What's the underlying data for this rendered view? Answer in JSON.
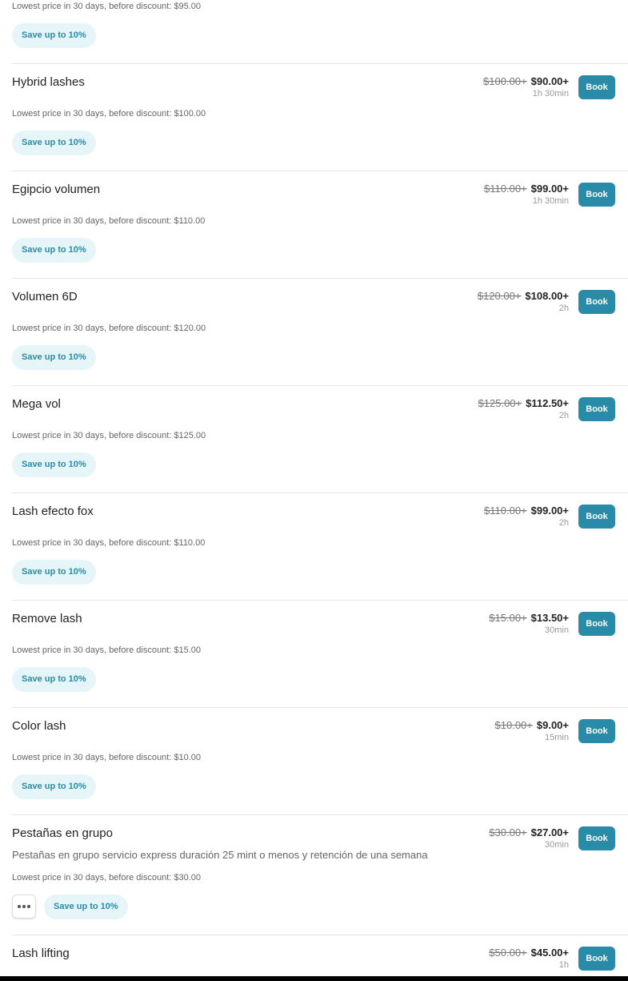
{
  "top_partial": {
    "lowest_price": "Lowest price in 30 days, before discount: $95.00",
    "badge": "Save up to 10%"
  },
  "services": [
    {
      "name": "Hybrid lashes",
      "old_price": "$100.00+",
      "new_price": "$90.00+",
      "duration": "1h 30min",
      "lowest_price": "Lowest price in 30 days, before discount: $100.00",
      "badge": "Save up to 10%",
      "book_label": "Book"
    },
    {
      "name": "Egipcio volumen",
      "old_price": "$110.00+",
      "new_price": "$99.00+",
      "duration": "1h 30min",
      "lowest_price": "Lowest price in 30 days, before discount: $110.00",
      "badge": "Save up to 10%",
      "book_label": "Book"
    },
    {
      "name": "Volumen 6D",
      "old_price": "$120.00+",
      "new_price": "$108.00+",
      "duration": "2h",
      "lowest_price": "Lowest price in 30 days, before discount: $120.00",
      "badge": "Save up to 10%",
      "book_label": "Book"
    },
    {
      "name": "Mega vol",
      "old_price": "$125.00+",
      "new_price": "$112.50+",
      "duration": "2h",
      "lowest_price": "Lowest price in 30 days, before discount: $125.00",
      "badge": "Save up to 10%",
      "book_label": "Book"
    },
    {
      "name": "Lash efecto fox",
      "old_price": "$110.00+",
      "new_price": "$99.00+",
      "duration": "2h",
      "lowest_price": "Lowest price in 30 days, before discount: $110.00",
      "badge": "Save up to 10%",
      "book_label": "Book"
    },
    {
      "name": "Remove lash",
      "old_price": "$15.00+",
      "new_price": "$13.50+",
      "duration": "30min",
      "lowest_price": "Lowest price in 30 days, before discount: $15.00",
      "badge": "Save up to 10%",
      "book_label": "Book"
    },
    {
      "name": "Color lash",
      "old_price": "$10.00+",
      "new_price": "$9.00+",
      "duration": "15min",
      "lowest_price": "Lowest price in 30 days, before discount: $10.00",
      "badge": "Save up to 10%",
      "book_label": "Book"
    },
    {
      "name": "Pestañas en grupo",
      "description": "Pestañas en grupo servicio express duración 25 mint o menos y retención de una semana",
      "old_price": "$30.00+",
      "new_price": "$27.00+",
      "duration": "30min",
      "lowest_price": "Lowest price in 30 days, before discount: $30.00",
      "badge": "Save up to 10%",
      "book_label": "Book",
      "more_icon": "more-dots-icon"
    },
    {
      "name": "Lash lifting",
      "old_price": "$50.00+",
      "new_price": "$45.00+",
      "duration": "1h",
      "book_label": "Book"
    }
  ],
  "colors": {
    "accent": "#2a8ba8",
    "badge_bg": "#e6f6f8",
    "divider": "#e6e6e6",
    "muted_text": "#666666"
  }
}
